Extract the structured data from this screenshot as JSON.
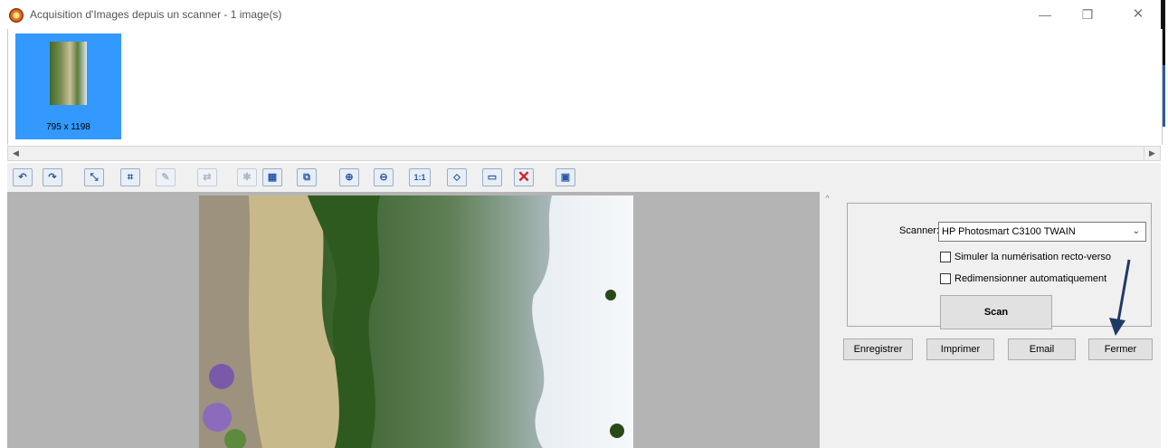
{
  "window": {
    "title": "Acquisition d'Images depuis un scanner  -  1 image(s)",
    "minimize": "—",
    "maximize": "❐",
    "close": "✕"
  },
  "thumbnails": [
    {
      "label": "795 x 1198",
      "selected": true
    }
  ],
  "scrollbar": {
    "left": "◀",
    "right": "▶"
  },
  "toolbar": [
    {
      "icon": "rotate-left-icon",
      "glyph": "↶"
    },
    {
      "icon": "rotate-right-icon",
      "glyph": "↷"
    },
    {
      "icon": "resize-icon",
      "glyph": "⤡"
    },
    {
      "icon": "crop-icon",
      "glyph": "⌗"
    },
    {
      "icon": "edit-icon",
      "glyph": "✎"
    },
    {
      "icon": "flip-icon",
      "glyph": "⇄"
    },
    {
      "icon": "new-page-icon",
      "glyph": "✱"
    },
    {
      "icon": "image-properties-icon",
      "glyph": "▦"
    },
    {
      "icon": "copy-icon",
      "glyph": "⧉"
    },
    {
      "icon": "zoom-in-icon",
      "glyph": "⊕"
    },
    {
      "icon": "zoom-out-icon",
      "glyph": "⊖"
    },
    {
      "icon": "actual-size-icon",
      "glyph": "1:1"
    },
    {
      "icon": "fit-window-icon",
      "glyph": "⬦"
    },
    {
      "icon": "fit-width-icon",
      "glyph": "▭"
    },
    {
      "icon": "delete-icon",
      "glyph": "✕"
    },
    {
      "icon": "paste-icon",
      "glyph": "▣"
    }
  ],
  "panel": {
    "scanner_label": "Scanner:",
    "scanner_value": "HP Photosmart C3100 TWAIN",
    "scanner_chevron": "⌄",
    "simulate_duplex": "Simuler la numérisation recto-verso",
    "auto_resize": "Redimensionner automatiquement",
    "scan": "Scan",
    "save": "Enregistrer",
    "print": "Imprimer",
    "email": "Email",
    "close": "Fermer",
    "scroll_up": "^"
  },
  "colors": {
    "selection": "#3399ff",
    "preview_background": "#b4b4b4",
    "panel_background": "#f0f0f0",
    "annotation_arrow": "#1f3a66"
  }
}
